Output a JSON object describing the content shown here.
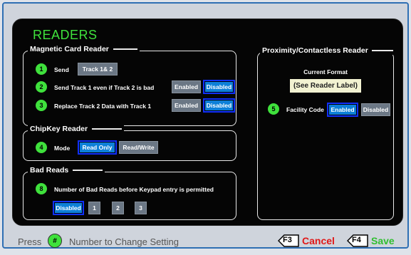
{
  "screen_title": "READERS",
  "magnetic": {
    "title": "Magnetic Card Reader",
    "rows": [
      {
        "num": "1",
        "label": "Send",
        "options": [
          "Track 1& 2"
        ],
        "selected": null
      },
      {
        "num": "2",
        "label": "Send Track 1 even if Track 2 is bad",
        "options": [
          "Enabled",
          "Disabled"
        ],
        "selected": "Disabled"
      },
      {
        "num": "3",
        "label": "Replace Track 2 Data with Track 1",
        "options": [
          "Enabled",
          "Disabled"
        ],
        "selected": "Disabled"
      }
    ]
  },
  "chipkey": {
    "title": "ChipKey Reader",
    "row": {
      "num": "4",
      "label": "Mode",
      "options": [
        "Read Only",
        "Read/Write"
      ],
      "selected": "Read Only"
    }
  },
  "badreads": {
    "title": "Bad Reads",
    "row": {
      "num": "8",
      "label": "Number of Bad Reads before Keypad entry is permitted",
      "options": [
        "Disabled",
        "1",
        "2",
        "3"
      ],
      "selected": "Disabled"
    }
  },
  "proximity": {
    "title": "Proximity/Contactless Reader",
    "current_format_label": "Current Format",
    "current_format_value": "(See Reader Label)",
    "row": {
      "num": "5",
      "label": "Facility Code",
      "options": [
        "Enabled",
        "Disabled"
      ],
      "selected": "Enabled"
    }
  },
  "footer": {
    "press": "Press",
    "hash_key": "#",
    "instruction": "Number to Change Setting",
    "cancel_key": "F3",
    "cancel_label": "Cancel",
    "save_key": "F4",
    "save_label": "Save"
  },
  "colors": {
    "accent_green": "#3fe13c",
    "selected_blue": "#0d80d8",
    "cancel_red": "#e01818",
    "save_green": "#2fbf2f"
  }
}
